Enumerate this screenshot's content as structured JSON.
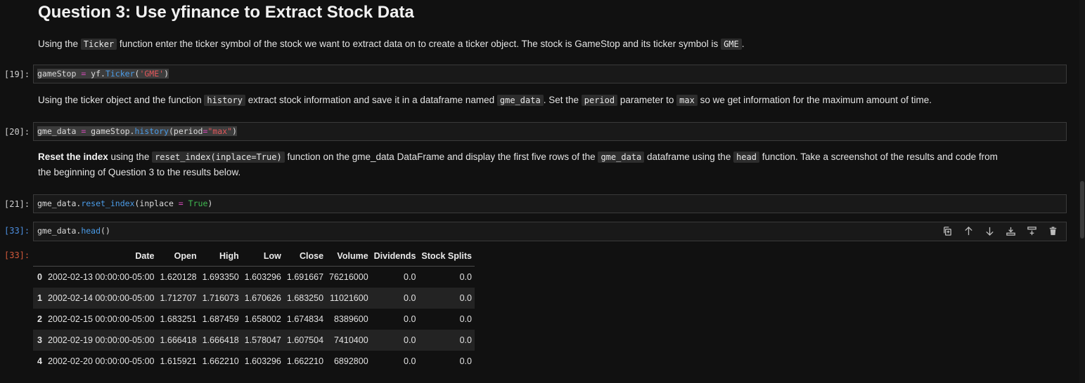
{
  "heading": "Question 3: Use yfinance to Extract Stock Data",
  "md1": {
    "t1": "Using the ",
    "c1": "Ticker",
    "t2": " function enter the ticker symbol of the stock we want to extract data on to create a ticker object. The stock is GameStop and its ticker symbol is ",
    "c2": "GME",
    "t3": "."
  },
  "md2": {
    "t1": "Using the ticker object and the function ",
    "c1": "history",
    "t2": " extract stock information and save it in a dataframe named ",
    "c2": "gme_data",
    "t3": ". Set the ",
    "c3": "period",
    "t4": " parameter to ",
    "c4": "max",
    "t5": " so we get information for the maximum amount of time."
  },
  "md3": {
    "b1": "Reset the index",
    "t1": " using the ",
    "c1": "reset_index(inplace=True)",
    "t2": " function on the gme_data DataFrame and display the first five rows of the ",
    "c2": "gme_data",
    "t3": " dataframe using the ",
    "c3": "head",
    "t4": " function. Take a screenshot of the results and code from",
    "line2": "the beginning of Question 3 to the results below."
  },
  "cells": {
    "c19": {
      "prompt": "[19]:",
      "p1": "gameStop ",
      "p2": "=",
      "p3": " yf.",
      "p4": "Ticker",
      "p5": "(",
      "p6": "'GME'",
      "p7": ")"
    },
    "c20": {
      "prompt": "[20]:",
      "p1": "gme_data ",
      "p2": "=",
      "p3": " gameStop.",
      "p4": "history",
      "p5": "(period",
      "p6": "=",
      "p7": "\"max\"",
      "p8": ")"
    },
    "c21": {
      "prompt": "[21]:",
      "p1": "gme_data.",
      "p2": "reset_index",
      "p3": "(inplace ",
      "p4": "=",
      "p5": " ",
      "p6": "True",
      "p7": ")"
    },
    "c33": {
      "prompt": "[33]:",
      "p1": "gme_data.",
      "p2": "head",
      "p3": "()"
    },
    "out33": {
      "prompt": "[33]:"
    }
  },
  "toolbar": {
    "icons": [
      "duplicate-icon",
      "arrow-up-icon",
      "arrow-down-icon",
      "insert-below-icon",
      "insert-above-icon",
      "trash-icon"
    ]
  },
  "table": {
    "columns": [
      "",
      "Date",
      "Open",
      "High",
      "Low",
      "Close",
      "Volume",
      "Dividends",
      "Stock Splits"
    ],
    "rows": [
      [
        "0",
        "2002-02-13 00:00:00-05:00",
        "1.620128",
        "1.693350",
        "1.603296",
        "1.691667",
        "76216000",
        "0.0",
        "0.0"
      ],
      [
        "1",
        "2002-02-14 00:00:00-05:00",
        "1.712707",
        "1.716073",
        "1.670626",
        "1.683250",
        "11021600",
        "0.0",
        "0.0"
      ],
      [
        "2",
        "2002-02-15 00:00:00-05:00",
        "1.683251",
        "1.687459",
        "1.658002",
        "1.674834",
        "8389600",
        "0.0",
        "0.0"
      ],
      [
        "3",
        "2002-02-19 00:00:00-05:00",
        "1.666418",
        "1.666418",
        "1.578047",
        "1.607504",
        "7410400",
        "0.0",
        "0.0"
      ],
      [
        "4",
        "2002-02-20 00:00:00-05:00",
        "1.615921",
        "1.662210",
        "1.603296",
        "1.662210",
        "6892800",
        "0.0",
        "0.0"
      ]
    ]
  }
}
